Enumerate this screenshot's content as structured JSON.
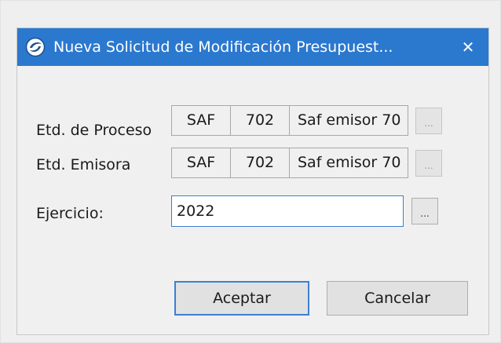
{
  "window": {
    "title": "Nueva Solicitud de Modificación Presupuest...",
    "close_glyph": "✕",
    "titlebar_color": "#2b78cf"
  },
  "form": {
    "proceso": {
      "label": "Etd. de Proceso",
      "code": "SAF",
      "number": "702",
      "name": "Saf emisor 70",
      "lookup_label": "..."
    },
    "emisora": {
      "label": "Etd. Emisora",
      "code": "SAF",
      "number": "702",
      "name": "Saf emisor 70",
      "lookup_label": "..."
    },
    "ejercicio": {
      "label": "Ejercicio:",
      "value": "2022",
      "lookup_label": "..."
    }
  },
  "buttons": {
    "accept": "Aceptar",
    "cancel": "Cancelar"
  },
  "icons": {
    "app": "app-logo-icon",
    "close": "close-icon",
    "lookup": "ellipsis-icon"
  }
}
